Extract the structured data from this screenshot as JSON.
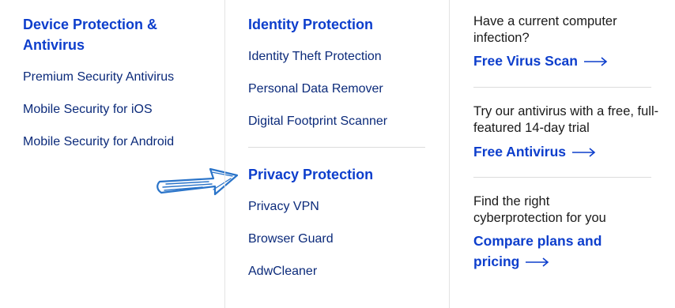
{
  "device": {
    "heading": "Device Protection & Antivirus",
    "links": [
      "Premium Security Antivirus",
      "Mobile Security for iOS",
      "Mobile Security for Android"
    ]
  },
  "identity": {
    "heading": "Identity Protection",
    "links": [
      "Identity Theft Protection",
      "Personal Data Remover",
      "Digital Footprint Scanner"
    ]
  },
  "privacy": {
    "heading": "Privacy Protection",
    "links": [
      "Privacy VPN",
      "Browser Guard",
      "AdwCleaner"
    ]
  },
  "promos": [
    {
      "text": "Have a current computer infection?",
      "cta": "Free Virus Scan"
    },
    {
      "text": "Try our antivirus with a free, full-featured 14-day trial",
      "cta": "Free Antivirus"
    },
    {
      "text": "Find the right cyberprotection for you",
      "cta": "Compare plans and pricing"
    }
  ],
  "colors": {
    "heading": "#0d3ecc",
    "link": "#0b2a7a",
    "annotation": "#2a74c9"
  },
  "icons": {
    "cta_arrow": "arrow-right-icon",
    "annotation": "hand-drawn-arrow-icon"
  }
}
